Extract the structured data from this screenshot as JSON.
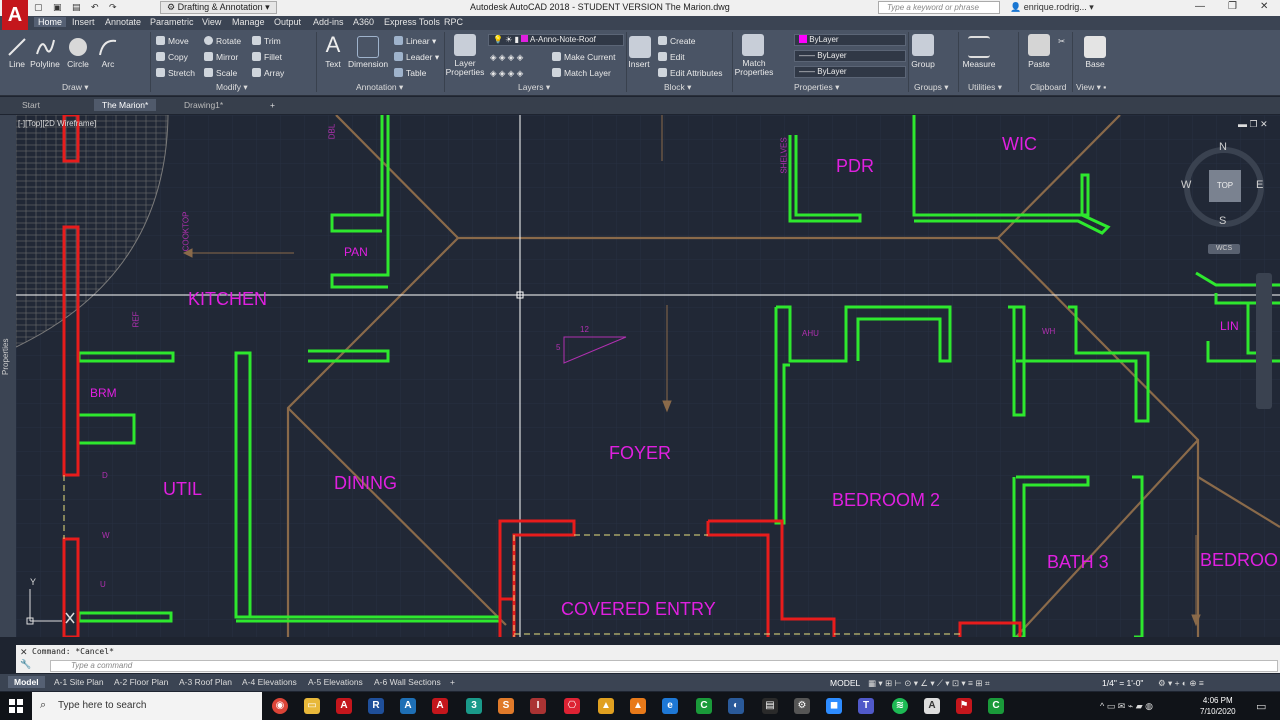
{
  "titlebar": {
    "app_logo": "A",
    "workspace": "Drafting & Annotation",
    "title": "Autodesk AutoCAD 2018 - STUDENT VERSION    The Marion.dwg",
    "search_placeholder": "Type a keyword or phrase",
    "user": "enrique.rodrig..."
  },
  "ribbon_tabs": [
    "Home",
    "Insert",
    "Annotate",
    "Parametric",
    "View",
    "Manage",
    "Output",
    "Add-ins",
    "A360",
    "Express Tools",
    "RPC"
  ],
  "ribbon": {
    "draw": {
      "title": "Draw",
      "line": "Line",
      "polyline": "Polyline",
      "circle": "Circle",
      "arc": "Arc"
    },
    "modify": {
      "title": "Modify",
      "move": "Move",
      "rotate": "Rotate",
      "trim": "Trim",
      "copy": "Copy",
      "mirror": "Mirror",
      "fillet": "Fillet",
      "stretch": "Stretch",
      "scale": "Scale",
      "array": "Array"
    },
    "annotation": {
      "title": "Annotation",
      "text": "Text",
      "dimension": "Dimension",
      "linear": "Linear",
      "leader": "Leader",
      "table": "Table"
    },
    "layers": {
      "title": "Layers",
      "layer_properties": "Layer Properties",
      "current_layer": "A-Anno-Note-Roof",
      "make_current": "Make Current",
      "match_layer": "Match Layer"
    },
    "block": {
      "title": "Block",
      "insert": "Insert",
      "create": "Create",
      "edit": "Edit",
      "edit_attributes": "Edit Attributes"
    },
    "properties": {
      "title": "Properties",
      "match_properties": "Match Properties",
      "color": "ByLayer",
      "linetype": "ByLayer",
      "lineweight": "ByLayer"
    },
    "groups": {
      "title": "Groups",
      "group": "Group"
    },
    "utilities": {
      "title": "Utilities",
      "measure": "Measure"
    },
    "clipboard": {
      "title": "Clipboard",
      "paste": "Paste"
    },
    "view": {
      "title": "View",
      "base": "Base"
    }
  },
  "doc_tabs": [
    "Start",
    "The Marion*",
    "Drawing1*"
  ],
  "viewport_label": "[-][Top][2D Wireframe]",
  "palette_label": "Properties",
  "viewcube": {
    "top": "TOP",
    "n": "N",
    "s": "S",
    "e": "E",
    "w": "W",
    "wcs": "WCS"
  },
  "rooms": {
    "kitchen": "KITCHEN",
    "pan": "PAN",
    "brm": "BRM",
    "util": "UTIL",
    "dining": "DINING",
    "foyer": "FOYER",
    "covered_entry": "COVERED ENTRY",
    "pdr": "PDR",
    "wic": "WIC",
    "bedroom2": "BEDROOM 2",
    "bath3": "BATH 3",
    "bedroom": "BEDROO",
    "lin": "LIN"
  },
  "tiny_labels": {
    "dbl": "DBL",
    "cooktop": "COOKTOP",
    "ref": "REF",
    "shelves": "SHELVES",
    "ahu": "AHU",
    "wh": "WH",
    "slope_12": "12",
    "slope_5": "5",
    "d": "D",
    "w": "W",
    "u": "U"
  },
  "command": {
    "history": "Command: *Cancel*",
    "placeholder": "Type a command"
  },
  "layout_tabs": [
    "Model",
    "A-1 Site Plan",
    "A-2 Floor Plan",
    "A-3 Roof Plan",
    "A-4 Elevations",
    "A-5 Elevations",
    "A-6 Wall Sections"
  ],
  "status": {
    "model": "MODEL",
    "scale": "1/4\" = 1'-0\""
  },
  "taskbar": {
    "search": "Type here to search",
    "time": "4:06 PM",
    "date": "7/10/2020"
  },
  "colors": {
    "wall_green": "#2ee82e",
    "wall_red": "#e81c1c",
    "roof_brown": "#8a6a4a",
    "text_magenta": "#e020e0",
    "canvas": "#212836"
  }
}
